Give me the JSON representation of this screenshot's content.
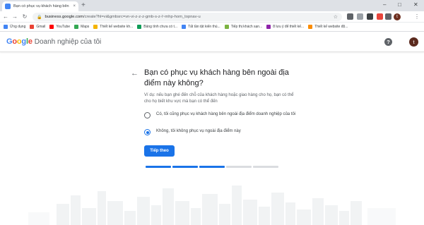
{
  "browser": {
    "tab_title": "Bạn có phục vụ khách hàng bên",
    "tab_close": "×",
    "new_tab": "+",
    "window_controls": {
      "minimize": "–",
      "maximize": "□",
      "close": "✕"
    },
    "url_host": "business.google.com",
    "url_path": "/create?hl=vi&gmbsrc=vn-vi-z-z-z-gmb-s-z-l~mhp-hom_topnav-u",
    "account_initial": "t",
    "bookmarks": [
      {
        "label": "Ứng dụng",
        "icon": "apps-icon",
        "color": "#4285f4"
      },
      {
        "label": "Gmail",
        "icon": "gmail-icon",
        "color": "#ea4335"
      },
      {
        "label": "YouTube",
        "icon": "youtube-icon",
        "color": "#ff0000"
      },
      {
        "label": "Maps",
        "icon": "maps-icon",
        "color": "#34a853"
      },
      {
        "label": "Thiết kế website kh...",
        "icon": "bookmark-icon",
        "color": "#f4b400"
      },
      {
        "label": "Bảng tính chưa có t...",
        "icon": "sheets-icon",
        "color": "#0f9d58"
      },
      {
        "label": "Tất tần tật kiến thú...",
        "icon": "bookmark-icon",
        "color": "#4285f4"
      },
      {
        "label": "Tiếp thị khách sạn...",
        "icon": "bookmark-icon",
        "color": "#7cb342"
      },
      {
        "label": "8 lưu ý để thiết kế...",
        "icon": "bookmark-icon",
        "color": "#8e24aa"
      },
      {
        "label": "Thiết kế website độ...",
        "icon": "bookmark-icon",
        "color": "#fb8c00"
      }
    ]
  },
  "header": {
    "logo_letters": [
      "G",
      "o",
      "o",
      "g",
      "l",
      "e"
    ],
    "product_name": "Doanh nghiệp của tôi",
    "help": "?",
    "avatar_initial": "t"
  },
  "main": {
    "back": "←",
    "question": "Bạn có phục vụ khách hàng bên ngoài địa điểm này không?",
    "hint": "Ví dụ: nếu bạn ghé đến chỗ của khách hàng hoặc giao hàng cho họ, bạn có thể cho họ biết khu vực mà bạn có thể đến",
    "options": [
      {
        "label": "Có, tôi cũng phục vụ khách hàng bên ngoài địa điểm doanh nghiệp của tôi",
        "selected": false
      },
      {
        "label": "Không, tôi không phục vụ ngoài địa điểm này",
        "selected": true
      }
    ],
    "next_button": "Tiếp theo",
    "progress": {
      "completed_steps": 3,
      "total_steps": 5
    }
  },
  "colors": {
    "accent": "#1a73e8",
    "progress_inactive": "#dadce0"
  }
}
